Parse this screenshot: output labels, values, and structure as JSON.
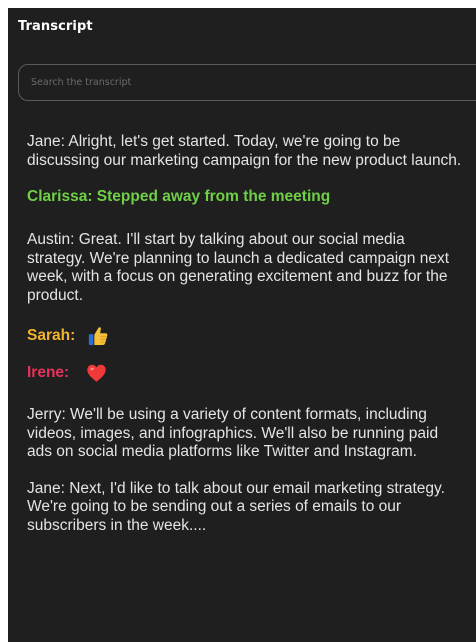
{
  "header": {
    "title": "Transcript"
  },
  "search": {
    "placeholder": "Search the transcript"
  },
  "transcript": {
    "entry1": "Jane: Alright, let's get started. Today, we're going to be discussing our marketing campaign for the new product launch.",
    "status1": "Clarissa: Stepped away from the meeting",
    "entry2": "Austin: Great. I'll start by talking about our social media strategy. We're planning to launch a dedicated campaign next week, with a focus on generating excitement and buzz for the product.",
    "reaction1": {
      "name": "Sarah:",
      "icon": "thumbs-up-icon",
      "color": "#f2b32d"
    },
    "reaction2": {
      "name": "Irene:",
      "icon": "heart-icon",
      "color": "#e5345a"
    },
    "entry3": "Jerry: We'll be using a variety of content formats, including videos, images, and infographics. We'll also be running paid ads on social media platforms like Twitter and Instagram.",
    "entry4": "Jane: Next, I'd like to talk about our email marketing strategy. We're going to be sending out a series of emails to our subscribers in the week...."
  },
  "colors": {
    "panel_bg": "#1f1f1f",
    "status_green": "#6fcf46"
  }
}
